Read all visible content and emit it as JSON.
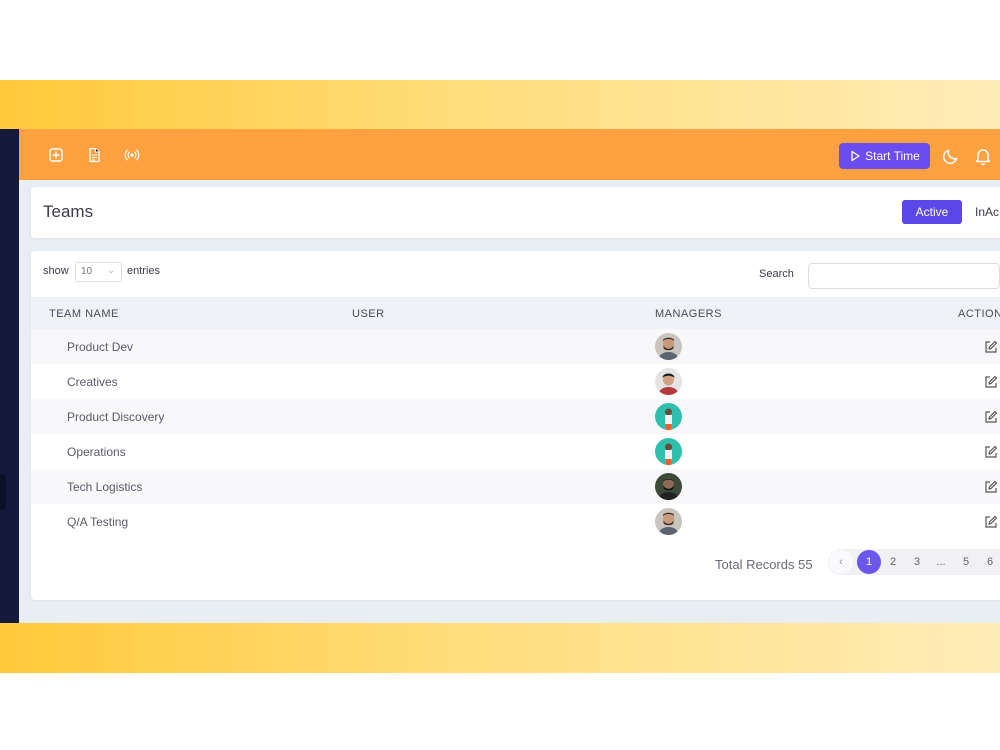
{
  "topbar": {
    "icons": [
      "add-square-icon",
      "document-icon",
      "broadcast-icon"
    ],
    "start_time_label": "Start Time",
    "accent_color": "#ffa041"
  },
  "header": {
    "title": "Teams",
    "tab_active": "Active",
    "tab_inactive": "InAc"
  },
  "table_controls": {
    "show_label": "show",
    "entries_value": "10",
    "entries_label": "entries",
    "search_label": "Search",
    "search_value": ""
  },
  "table": {
    "columns": [
      "TEAM NAME",
      "USER",
      "MANAGERS",
      "ACTION"
    ],
    "rows": [
      {
        "team": "Product Dev",
        "user": "",
        "manager_avatar": "bearded-man-avatar"
      },
      {
        "team": "Creatives",
        "user": "",
        "manager_avatar": "young-man-avatar"
      },
      {
        "team": "Product Discovery",
        "user": "",
        "manager_avatar": "teal-illustration-avatar"
      },
      {
        "team": "Operations",
        "user": "",
        "manager_avatar": "teal-illustration-avatar"
      },
      {
        "team": "Tech Logistics",
        "user": "",
        "manager_avatar": "dark-man-avatar"
      },
      {
        "team": "Q/A Testing",
        "user": "",
        "manager_avatar": "bearded-man-avatar"
      }
    ]
  },
  "pagination": {
    "total_label": "Total Records 55",
    "prev": "‹",
    "pages": [
      "1",
      "2",
      "3",
      "...",
      "5",
      "6"
    ],
    "current": "1"
  },
  "colors": {
    "primary": "#5b47e8",
    "band_start": "#ffc93a",
    "band_end": "#ffedb9",
    "sidebar": "#141a3a"
  }
}
